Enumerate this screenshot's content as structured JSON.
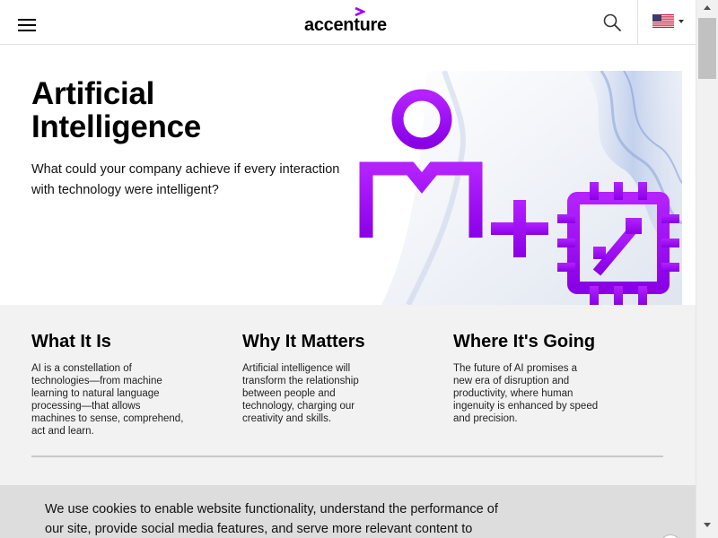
{
  "header": {
    "logo_text": "accenture",
    "menu_icon": "hamburger-menu-icon",
    "search_icon": "search-icon",
    "locale_icon": "us-flag-icon"
  },
  "hero": {
    "title_line1": "Artificial",
    "title_line2": "Intelligence",
    "subtitle": "What could your company achieve if every interaction with technology were intelligent?",
    "image_icons": [
      "person-icon",
      "plus-icon",
      "microchip-icon"
    ]
  },
  "columns": [
    {
      "heading": "What It Is",
      "body": "AI is a constellation of technologies—from machine learning to natural language processing—that allows machines to sense, comprehend, act and learn."
    },
    {
      "heading": "Why It Matters",
      "body": "Artificial intelligence will transform the relationship between people and technology, charging our creativity and skills."
    },
    {
      "heading": "Where It's Going",
      "body": "The future of AI promises a new era of disruption and productivity, where human ingenuity is enhanced by speed and precision."
    }
  ],
  "cookie": {
    "text": "We use cookies to enable website functionality, understand the performance of our site, provide social media features, and serve more relevant content to"
  },
  "colors": {
    "brand_purple": "#a100ff",
    "band_bg": "#f2f2f2",
    "cookie_bg": "#dddddd"
  }
}
